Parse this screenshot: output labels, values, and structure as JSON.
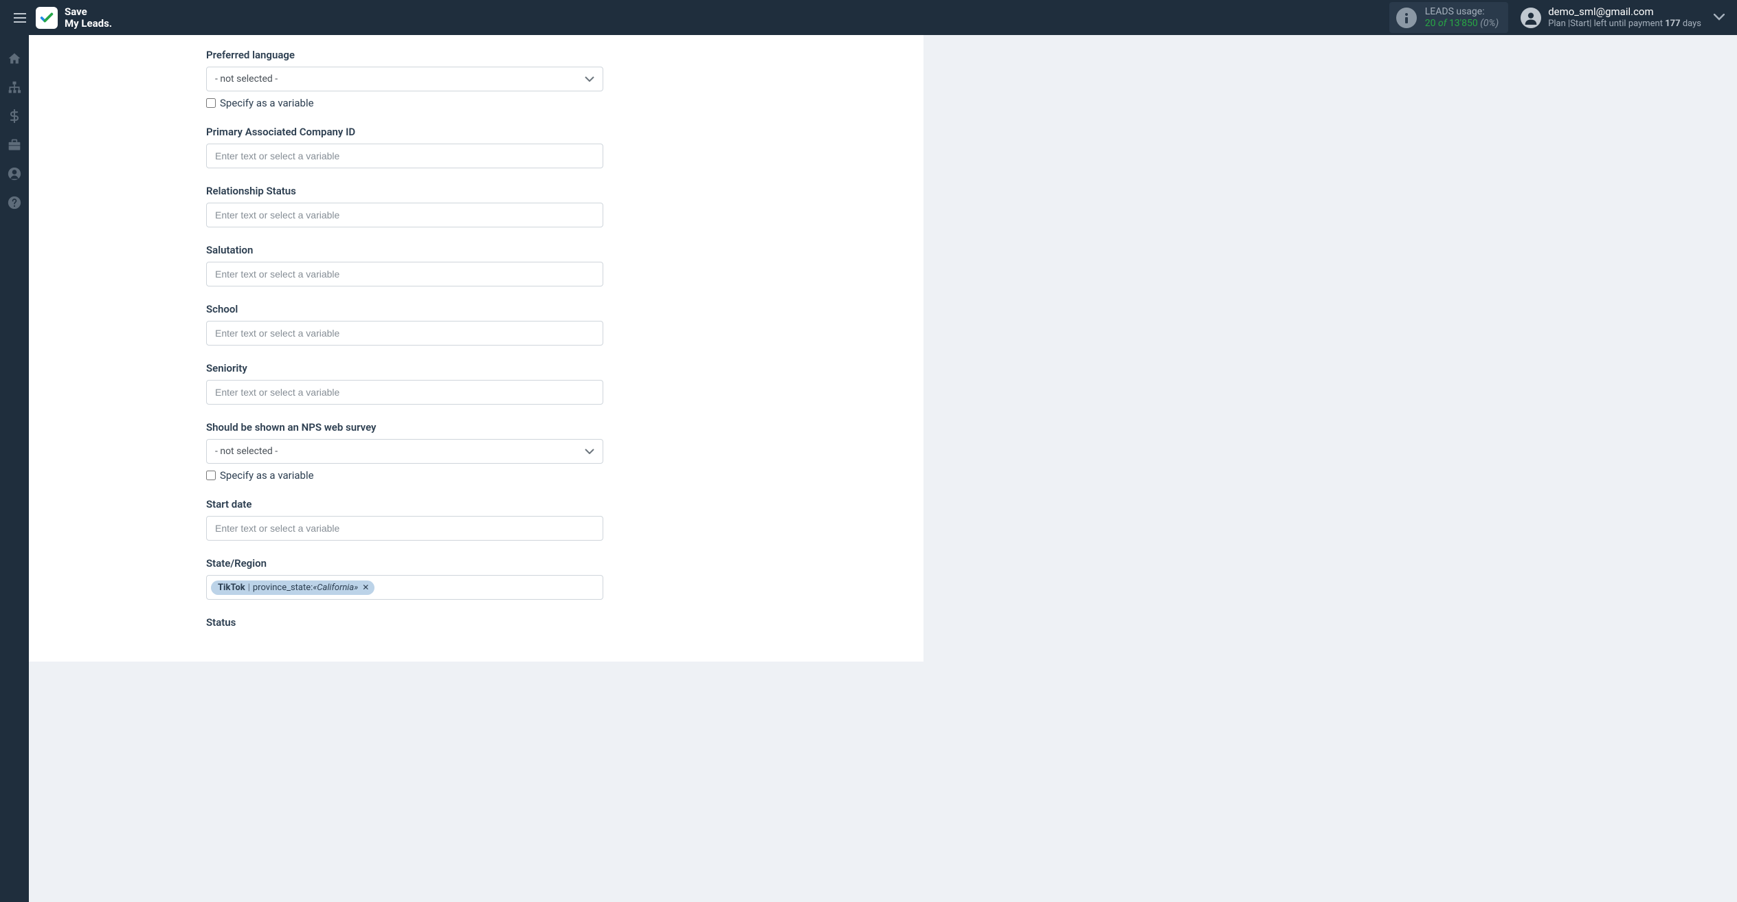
{
  "header": {
    "logo_line1": "Save",
    "logo_line2": "My Leads.",
    "usage": {
      "label": "LEADS usage:",
      "count": "20",
      "of": "of",
      "total": "13'850",
      "pct": "(0%)"
    },
    "user": {
      "email": "demo_sml@gmail.com",
      "plan_prefix": "Plan |Start| left until payment ",
      "plan_days": "177",
      "plan_suffix": " days"
    }
  },
  "form": {
    "placeholder_text": "Enter text or select a variable",
    "not_selected": "- not selected -",
    "specify_variable_label": "Specify as a variable",
    "fields": {
      "preferred_language": {
        "label": "Preferred language"
      },
      "primary_company_id": {
        "label": "Primary Associated Company ID"
      },
      "relationship_status": {
        "label": "Relationship Status"
      },
      "salutation": {
        "label": "Salutation"
      },
      "school": {
        "label": "School"
      },
      "seniority": {
        "label": "Seniority"
      },
      "nps_survey": {
        "label": "Should be shown an NPS web survey"
      },
      "start_date": {
        "label": "Start date"
      },
      "state_region": {
        "label": "State/Region",
        "tag_source": "TikTok",
        "tag_field": "province_state: ",
        "tag_value": "«California»"
      },
      "status": {
        "label": "Status"
      }
    }
  }
}
